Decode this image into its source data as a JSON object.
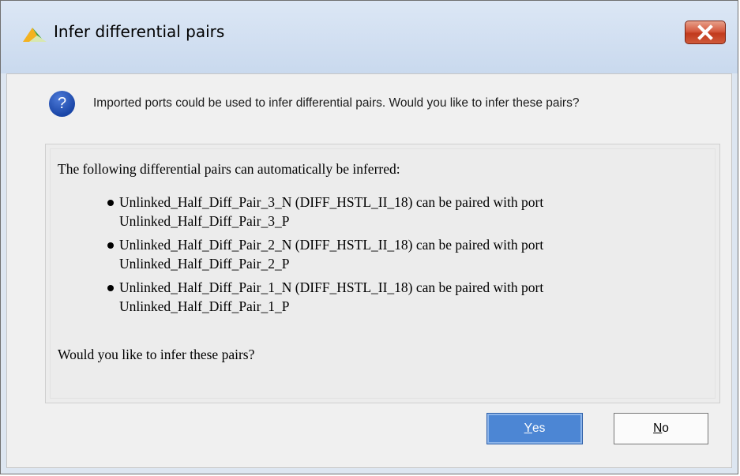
{
  "window": {
    "title": "Infer differential pairs",
    "close_icon": "close-icon",
    "logo_icon": "app-logo-icon"
  },
  "message": {
    "icon": "question-icon",
    "icon_glyph": "?",
    "text": "Imported ports could be used to infer differential pairs. Would you like to infer these pairs?"
  },
  "panel": {
    "heading": "The following differential pairs can automatically be inferred:",
    "pairs": [
      {
        "line1": "Unlinked_Half_Diff_Pair_3_N (DIFF_HSTL_II_18) can be paired with port",
        "line2": "Unlinked_Half_Diff_Pair_3_P"
      },
      {
        "line1": "Unlinked_Half_Diff_Pair_2_N (DIFF_HSTL_II_18) can be paired with port",
        "line2": "Unlinked_Half_Diff_Pair_2_P"
      },
      {
        "line1": "Unlinked_Half_Diff_Pair_1_N (DIFF_HSTL_II_18) can be paired with port",
        "line2": "Unlinked_Half_Diff_Pair_1_P"
      }
    ],
    "question": "Would you like to infer these pairs?"
  },
  "buttons": {
    "yes_mnemonic": "Y",
    "yes_rest": "es",
    "no_mnemonic": "N",
    "no_rest": "o"
  },
  "colors": {
    "titlebar": "#dce7f5",
    "primary_button": "#4c86d4",
    "close_button": "#c23a1d",
    "question_icon": "#1a46a7"
  }
}
